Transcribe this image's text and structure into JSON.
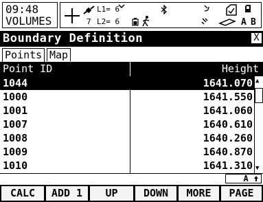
{
  "status": {
    "time": "09:48",
    "mode": "VOLUMES",
    "satellites": "7",
    "l1": "L1= 6",
    "l2": "L2= 6",
    "quality_char": "A",
    "page_char": "B"
  },
  "window": {
    "title": "Boundary Definition",
    "close_label": "X"
  },
  "tabs": [
    {
      "label": "Points",
      "active": true
    },
    {
      "label": "Map",
      "active": false
    }
  ],
  "table": {
    "headers": [
      "Point ID",
      "Height"
    ],
    "rows": [
      {
        "id": "1044",
        "height": "1641.070",
        "selected": true
      },
      {
        "id": "1000",
        "height": "1641.550",
        "selected": false
      },
      {
        "id": "1001",
        "height": "1641.060",
        "selected": false
      },
      {
        "id": "1007",
        "height": "1640.610",
        "selected": false
      },
      {
        "id": "1008",
        "height": "1640.260",
        "selected": false
      },
      {
        "id": "1009",
        "height": "1640.870",
        "selected": false
      },
      {
        "id": "1010",
        "height": "1641.310",
        "selected": false
      }
    ]
  },
  "indicator": "A",
  "function_keys": [
    "CALC",
    "ADD 1",
    "UP",
    "DOWN",
    "MORE",
    "PAGE"
  ]
}
